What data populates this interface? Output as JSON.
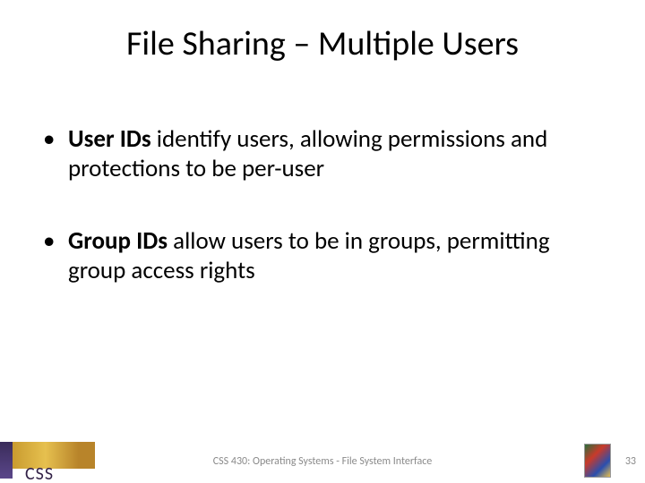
{
  "title": "File Sharing – Multiple Users",
  "bullets": [
    {
      "bold": "User IDs",
      "rest": " identify users, allowing permissions and protections to be per-user"
    },
    {
      "bold": "Group IDs",
      "rest": " allow users to be in groups, permitting group access rights"
    }
  ],
  "footer": "CSS 430: Operating Systems - File System Interface",
  "page_number": "33",
  "logo_text": "CSS"
}
